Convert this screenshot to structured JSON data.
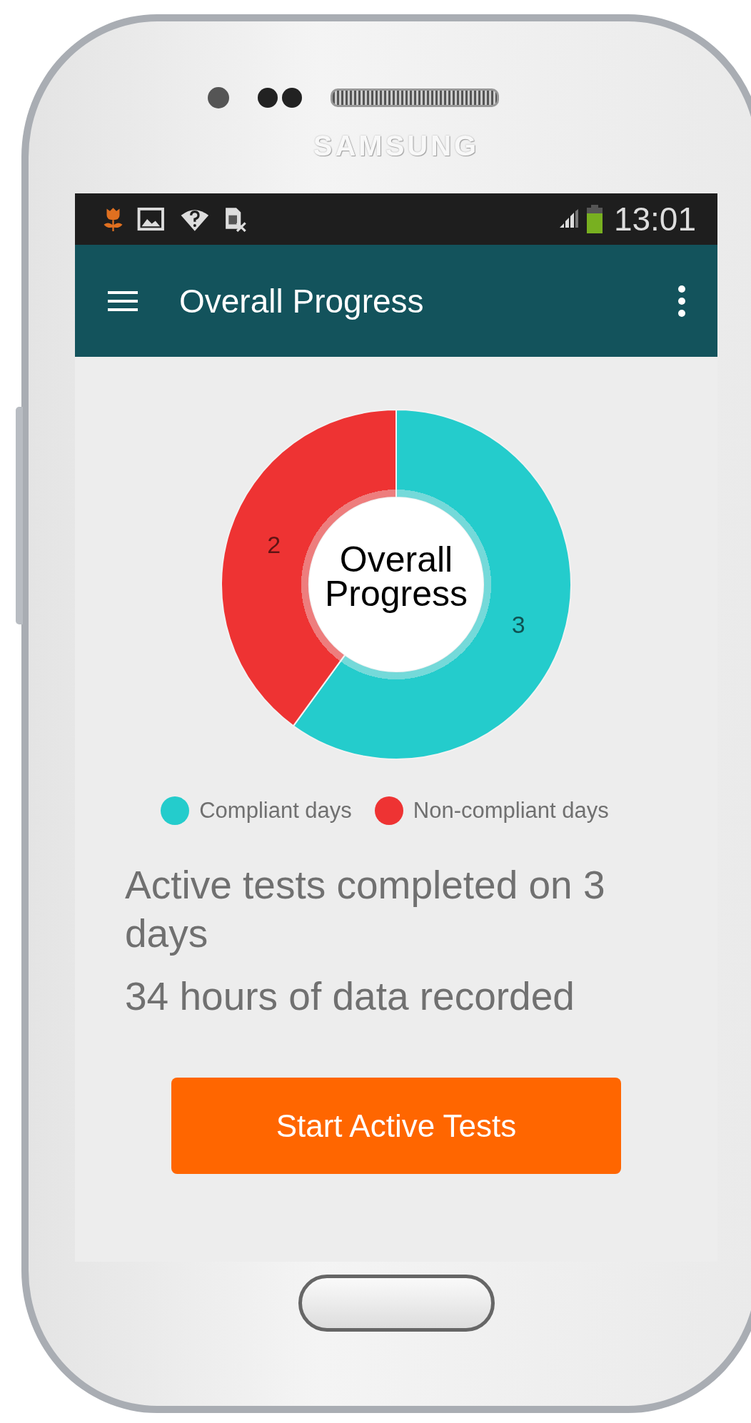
{
  "device": {
    "brand": "SAMSUNG"
  },
  "status_bar": {
    "time": "13:01"
  },
  "app_bar": {
    "title": "Overall Progress"
  },
  "chart": {
    "chart_data": {
      "type": "donut",
      "title": "Overall Progress",
      "categories": [
        "Compliant days",
        "Non-compliant days"
      ],
      "values": [
        3,
        2
      ],
      "data_labels": true
    },
    "legend": [
      {
        "color": "#24cccc"
      },
      {
        "color": "#ee3333"
      }
    ]
  },
  "summary": [
    "Active tests completed on 3 days",
    "34 hours of data recorded"
  ],
  "button": {
    "label": "Start Active Tests"
  }
}
